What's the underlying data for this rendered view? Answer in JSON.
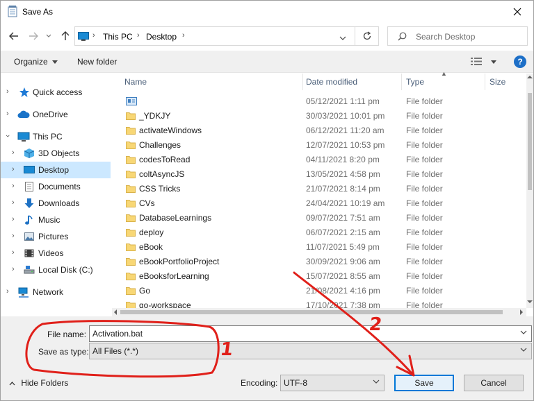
{
  "window": {
    "title": "Save As"
  },
  "address": {
    "crumbs": [
      "This PC",
      "Desktop"
    ],
    "search_placeholder": "Search Desktop"
  },
  "toolbar": {
    "organize": "Organize",
    "new_folder": "New folder",
    "help": "?"
  },
  "nav_pane": {
    "items": [
      {
        "label": "Quick access",
        "icon": "star-icon"
      },
      {
        "label": "OneDrive",
        "icon": "cloud-icon"
      },
      {
        "label": "This PC",
        "icon": "computer-icon"
      },
      {
        "label": "3D Objects",
        "icon": "cube-icon"
      },
      {
        "label": "Desktop",
        "icon": "desktop-icon",
        "selected": true
      },
      {
        "label": "Documents",
        "icon": "document-icon"
      },
      {
        "label": "Downloads",
        "icon": "download-icon"
      },
      {
        "label": "Music",
        "icon": "music-icon"
      },
      {
        "label": "Pictures",
        "icon": "picture-icon"
      },
      {
        "label": "Videos",
        "icon": "video-icon"
      },
      {
        "label": "Local Disk (C:)",
        "icon": "drive-icon"
      },
      {
        "label": "Network",
        "icon": "network-icon"
      }
    ]
  },
  "columns": {
    "name": "Name",
    "date": "Date modified",
    "type": "Type",
    "size": "Size"
  },
  "files": [
    {
      "name": "",
      "date": "05/12/2021 1:11 pm",
      "type": "File folder",
      "icon": "special-folder-icon"
    },
    {
      "name": "_YDKJY",
      "date": "30/03/2021 10:01 pm",
      "type": "File folder"
    },
    {
      "name": "activateWindows",
      "date": "06/12/2021 11:20 am",
      "type": "File folder"
    },
    {
      "name": "Challenges",
      "date": "12/07/2021 10:53 pm",
      "type": "File folder"
    },
    {
      "name": "codesToRead",
      "date": "04/11/2021 8:20 pm",
      "type": "File folder"
    },
    {
      "name": "coltAsyncJS",
      "date": "13/05/2021 4:58 pm",
      "type": "File folder"
    },
    {
      "name": "CSS Tricks",
      "date": "21/07/2021 8:14 pm",
      "type": "File folder"
    },
    {
      "name": "CVs",
      "date": "24/04/2021 10:19 am",
      "type": "File folder"
    },
    {
      "name": "DatabaseLearnings",
      "date": "09/07/2021 7:51 am",
      "type": "File folder"
    },
    {
      "name": "deploy",
      "date": "06/07/2021 2:15 am",
      "type": "File folder"
    },
    {
      "name": "eBook",
      "date": "11/07/2021 5:49 pm",
      "type": "File folder"
    },
    {
      "name": "eBookPortfolioProject",
      "date": "30/09/2021 9:06 am",
      "type": "File folder"
    },
    {
      "name": "eBooksforLearning",
      "date": "15/07/2021 8:55 am",
      "type": "File folder"
    },
    {
      "name": "Go",
      "date": "21/08/2021 4:16 pm",
      "type": "File folder"
    },
    {
      "name": "go-workspace",
      "date": "17/10/2021 7:38 pm",
      "type": "File folder"
    }
  ],
  "form": {
    "file_name_label": "File name:",
    "file_name_value": "Activation.bat",
    "save_type_label": "Save as type:",
    "save_type_value": "All Files  (*.*)",
    "encoding_label": "Encoding:",
    "encoding_value": "UTF-8",
    "hide_folders": "Hide Folders",
    "save_button": "Save",
    "cancel_button": "Cancel"
  },
  "annotations": {
    "label_1": "1",
    "label_2": "2",
    "color": "#e0201a"
  },
  "colors": {
    "accent": "#0078d7",
    "selection": "#cce8ff",
    "folder": "#f8d775"
  }
}
